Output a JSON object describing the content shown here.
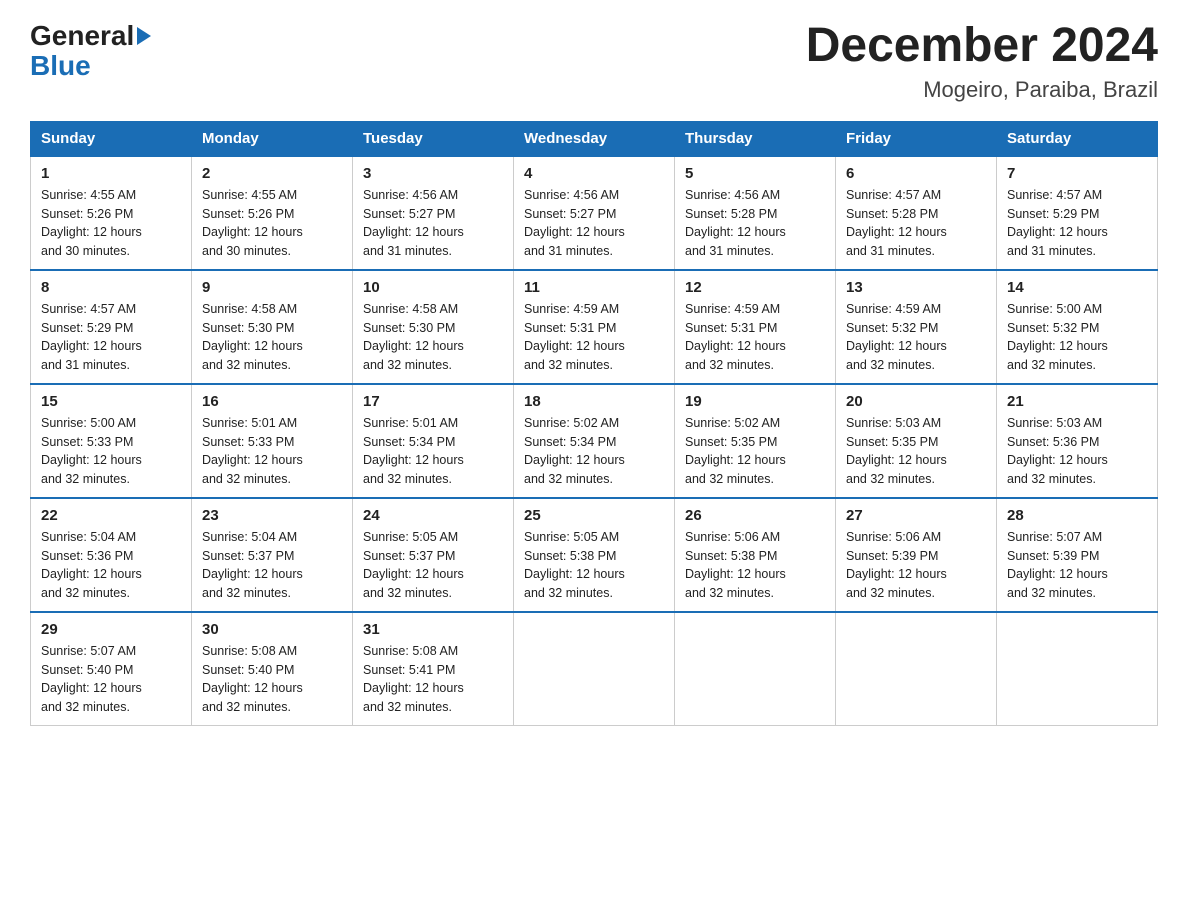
{
  "logo": {
    "general": "General",
    "blue": "Blue"
  },
  "title": "December 2024",
  "subtitle": "Mogeiro, Paraiba, Brazil",
  "days_of_week": [
    "Sunday",
    "Monday",
    "Tuesday",
    "Wednesday",
    "Thursday",
    "Friday",
    "Saturday"
  ],
  "weeks": [
    [
      {
        "day": "1",
        "sunrise": "4:55 AM",
        "sunset": "5:26 PM",
        "daylight": "12 hours and 30 minutes."
      },
      {
        "day": "2",
        "sunrise": "4:55 AM",
        "sunset": "5:26 PM",
        "daylight": "12 hours and 30 minutes."
      },
      {
        "day": "3",
        "sunrise": "4:56 AM",
        "sunset": "5:27 PM",
        "daylight": "12 hours and 31 minutes."
      },
      {
        "day": "4",
        "sunrise": "4:56 AM",
        "sunset": "5:27 PM",
        "daylight": "12 hours and 31 minutes."
      },
      {
        "day": "5",
        "sunrise": "4:56 AM",
        "sunset": "5:28 PM",
        "daylight": "12 hours and 31 minutes."
      },
      {
        "day": "6",
        "sunrise": "4:57 AM",
        "sunset": "5:28 PM",
        "daylight": "12 hours and 31 minutes."
      },
      {
        "day": "7",
        "sunrise": "4:57 AM",
        "sunset": "5:29 PM",
        "daylight": "12 hours and 31 minutes."
      }
    ],
    [
      {
        "day": "8",
        "sunrise": "4:57 AM",
        "sunset": "5:29 PM",
        "daylight": "12 hours and 31 minutes."
      },
      {
        "day": "9",
        "sunrise": "4:58 AM",
        "sunset": "5:30 PM",
        "daylight": "12 hours and 32 minutes."
      },
      {
        "day": "10",
        "sunrise": "4:58 AM",
        "sunset": "5:30 PM",
        "daylight": "12 hours and 32 minutes."
      },
      {
        "day": "11",
        "sunrise": "4:59 AM",
        "sunset": "5:31 PM",
        "daylight": "12 hours and 32 minutes."
      },
      {
        "day": "12",
        "sunrise": "4:59 AM",
        "sunset": "5:31 PM",
        "daylight": "12 hours and 32 minutes."
      },
      {
        "day": "13",
        "sunrise": "4:59 AM",
        "sunset": "5:32 PM",
        "daylight": "12 hours and 32 minutes."
      },
      {
        "day": "14",
        "sunrise": "5:00 AM",
        "sunset": "5:32 PM",
        "daylight": "12 hours and 32 minutes."
      }
    ],
    [
      {
        "day": "15",
        "sunrise": "5:00 AM",
        "sunset": "5:33 PM",
        "daylight": "12 hours and 32 minutes."
      },
      {
        "day": "16",
        "sunrise": "5:01 AM",
        "sunset": "5:33 PM",
        "daylight": "12 hours and 32 minutes."
      },
      {
        "day": "17",
        "sunrise": "5:01 AM",
        "sunset": "5:34 PM",
        "daylight": "12 hours and 32 minutes."
      },
      {
        "day": "18",
        "sunrise": "5:02 AM",
        "sunset": "5:34 PM",
        "daylight": "12 hours and 32 minutes."
      },
      {
        "day": "19",
        "sunrise": "5:02 AM",
        "sunset": "5:35 PM",
        "daylight": "12 hours and 32 minutes."
      },
      {
        "day": "20",
        "sunrise": "5:03 AM",
        "sunset": "5:35 PM",
        "daylight": "12 hours and 32 minutes."
      },
      {
        "day": "21",
        "sunrise": "5:03 AM",
        "sunset": "5:36 PM",
        "daylight": "12 hours and 32 minutes."
      }
    ],
    [
      {
        "day": "22",
        "sunrise": "5:04 AM",
        "sunset": "5:36 PM",
        "daylight": "12 hours and 32 minutes."
      },
      {
        "day": "23",
        "sunrise": "5:04 AM",
        "sunset": "5:37 PM",
        "daylight": "12 hours and 32 minutes."
      },
      {
        "day": "24",
        "sunrise": "5:05 AM",
        "sunset": "5:37 PM",
        "daylight": "12 hours and 32 minutes."
      },
      {
        "day": "25",
        "sunrise": "5:05 AM",
        "sunset": "5:38 PM",
        "daylight": "12 hours and 32 minutes."
      },
      {
        "day": "26",
        "sunrise": "5:06 AM",
        "sunset": "5:38 PM",
        "daylight": "12 hours and 32 minutes."
      },
      {
        "day": "27",
        "sunrise": "5:06 AM",
        "sunset": "5:39 PM",
        "daylight": "12 hours and 32 minutes."
      },
      {
        "day": "28",
        "sunrise": "5:07 AM",
        "sunset": "5:39 PM",
        "daylight": "12 hours and 32 minutes."
      }
    ],
    [
      {
        "day": "29",
        "sunrise": "5:07 AM",
        "sunset": "5:40 PM",
        "daylight": "12 hours and 32 minutes."
      },
      {
        "day": "30",
        "sunrise": "5:08 AM",
        "sunset": "5:40 PM",
        "daylight": "12 hours and 32 minutes."
      },
      {
        "day": "31",
        "sunrise": "5:08 AM",
        "sunset": "5:41 PM",
        "daylight": "12 hours and 32 minutes."
      },
      null,
      null,
      null,
      null
    ]
  ],
  "labels": {
    "sunrise": "Sunrise:",
    "sunset": "Sunset:",
    "daylight": "Daylight:"
  }
}
